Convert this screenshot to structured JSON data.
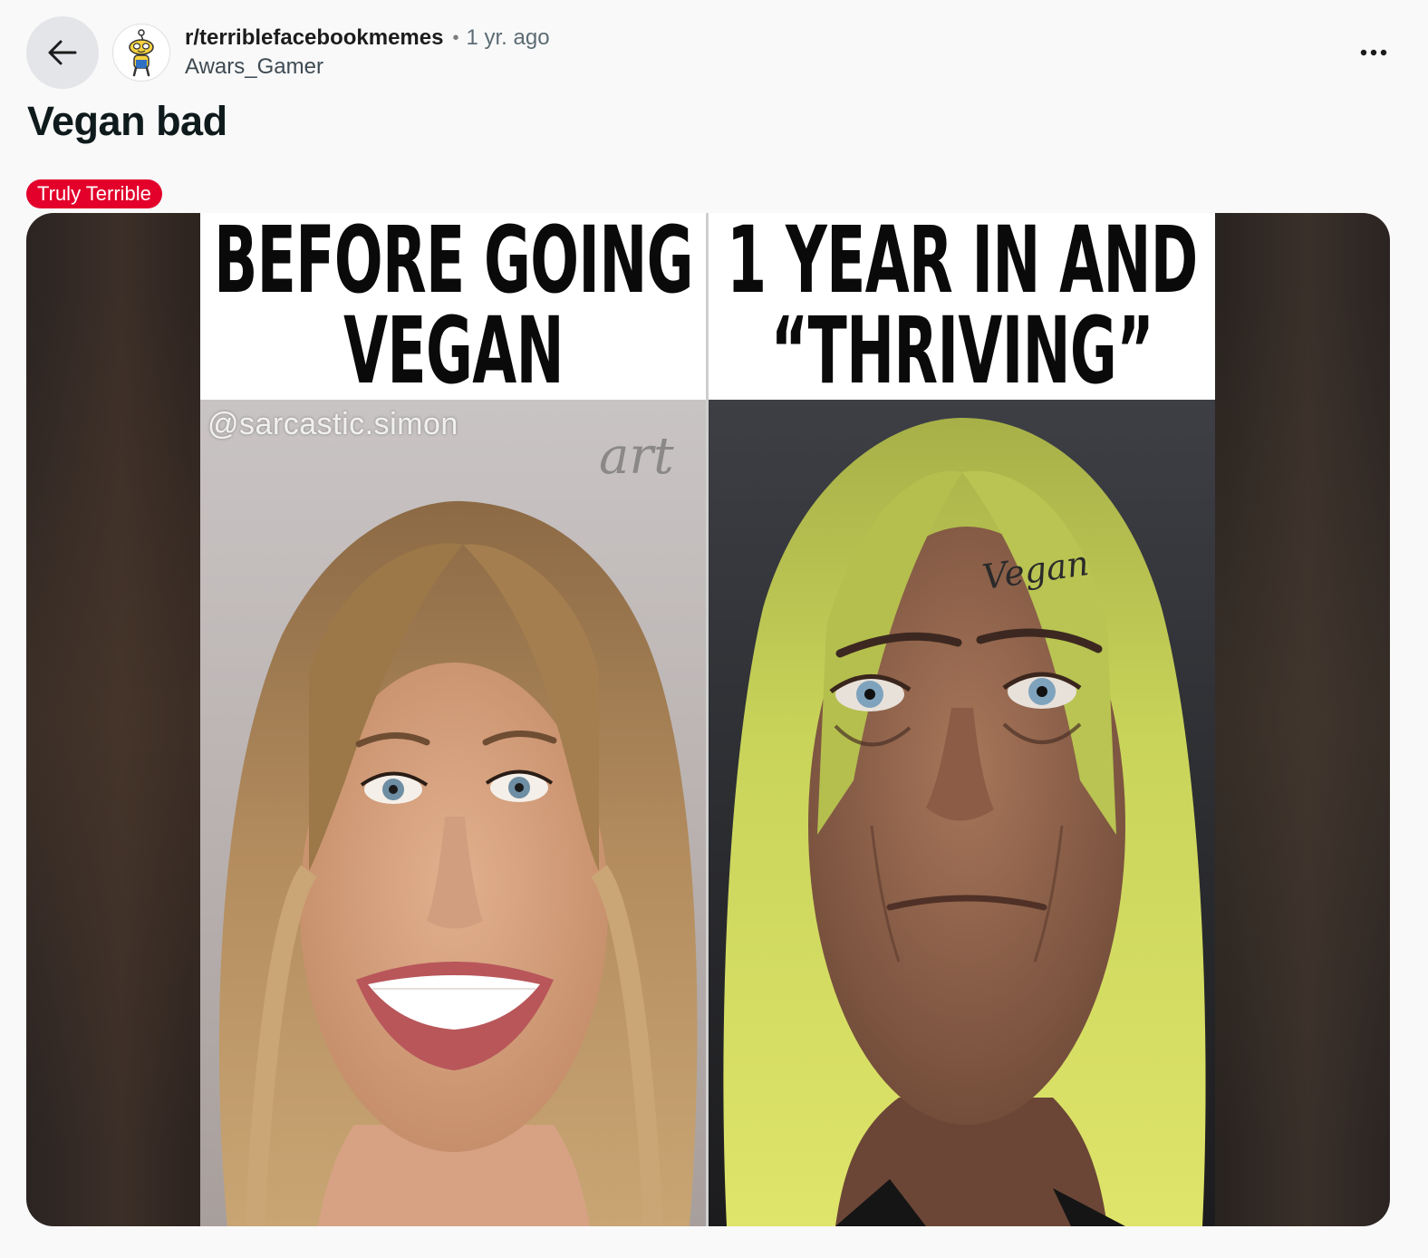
{
  "post": {
    "subreddit": "r/terriblefacebookmemes",
    "separator": "•",
    "time_ago": "1 yr. ago",
    "author": "Awars_Gamer",
    "title": "Vegan bad",
    "flair": "Truly Terrible"
  },
  "meme": {
    "left_caption_line1": "BEFORE GOING",
    "left_caption_line2": "VEGAN",
    "right_caption_line1": "1 YEAR IN AND",
    "right_caption_line2": "“THRIVING”",
    "watermark": "@sarcastic.simon",
    "tattoo": "Vegan"
  },
  "icons": {
    "back": "arrow-left-icon",
    "more": "ellipsis-horizontal-icon",
    "avatar": "snoo-avatar-icon"
  },
  "colors": {
    "flair_bg": "#e3012b",
    "page_bg": "#f9f9f9",
    "back_button_bg": "#e3e5e8"
  }
}
